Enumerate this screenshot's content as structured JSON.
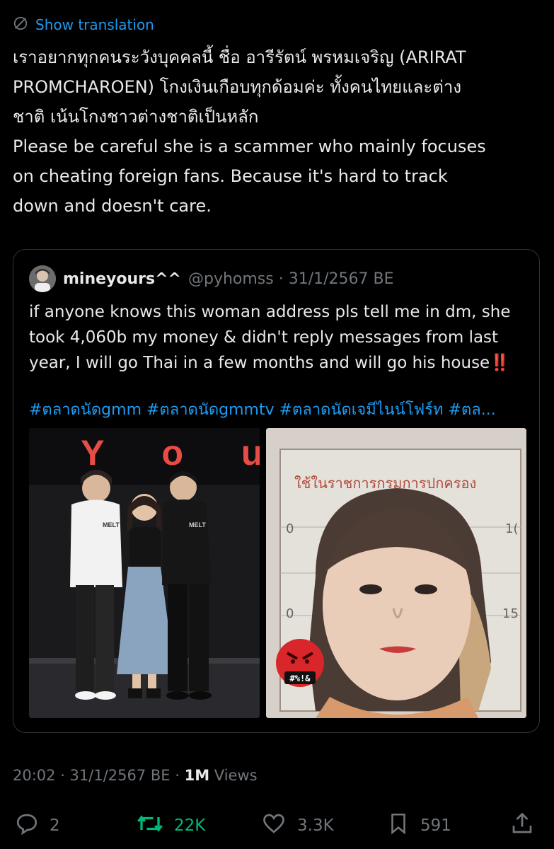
{
  "translate": {
    "label": "Show translation",
    "icon": "globe-slash-icon"
  },
  "tweet": {
    "thai_line1": "เราอยากทุกคนระวังบุคคลนี้ ชื่อ อารีรัตน์ พรหมเจริญ (ARIRAT",
    "thai_line2": "PROMCHAROEN) โกงเงินเกือบทุกด้อมค่ะ ทั้งคนไทยและต่าง",
    "thai_line3": "ชาติ เน้นโกงชาวต่างชาติเป็นหลัก",
    "en_line1": "Please be careful she is a scammer who mainly focuses",
    "en_line2": "on cheating foreign fans.  Because it's hard to track",
    "en_line3": "down and doesn't care."
  },
  "quote": {
    "display_name": "mineyours^^",
    "meta": "@pyhomss · 31/1/2567 BE",
    "line1": "if anyone knows this woman address pls tell me in dm, she",
    "line2": "took 4,060b my money & didn't reply messages from last",
    "line3": "year, I will go Thai in a few months and will go his house",
    "bang": "‼️",
    "hashtags": "#ตลาดนัดgmm #ตลาดนัดgmmtv #ตลาดนัดเจมีไนน์โฟร์ท #ตล...",
    "left_image": {
      "backdrop_text": "o Y o u",
      "shirt_text": "MELT",
      "shirt_text_2": "MELT"
    },
    "right_image": {
      "stamp_text": "ใช้ในราชการกรมการปกครอง",
      "emoji_text": "#%!&",
      "ruler_left": "0",
      "ruler_left2": "0",
      "ruler_right": "1(",
      "ruler_right2": "15"
    }
  },
  "footer": {
    "time": "20:02 · 31/1/2567 BE · ",
    "views_count": "1M",
    "views_label": " Views"
  },
  "actions": {
    "replies": "2",
    "reposts": "22K",
    "likes": "3.3K",
    "bookmarks": "591"
  },
  "colors": {
    "accent": "#1d9bf0",
    "repost": "#00ba7c",
    "muted": "#71767b",
    "text": "#e7e9ea"
  }
}
